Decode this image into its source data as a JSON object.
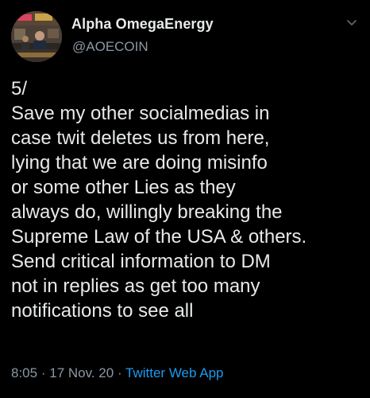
{
  "author": {
    "display_name": "Alpha OmegaEnergy",
    "handle": "@AOECOIN",
    "avatar_icon": "profile-photo"
  },
  "tweet": {
    "text": "5/\nSave my other socialmedias in\ncase twit deletes us from here,\nlying that we are doing misinfo\nor some other Lies as they\nalways do, willingly breaking the\nSupreme Law of the USA & others.\nSend critical information to DM\nnot in replies as get too many\nnotifications to see all",
    "time": "8:05",
    "separator": "·",
    "date": "17 Nov. 20",
    "source": "Twitter Web App"
  },
  "colors": {
    "background": "#000000",
    "text": "#e7e9ea",
    "secondary": "#8b98a5",
    "link": "#1d9bf0"
  }
}
